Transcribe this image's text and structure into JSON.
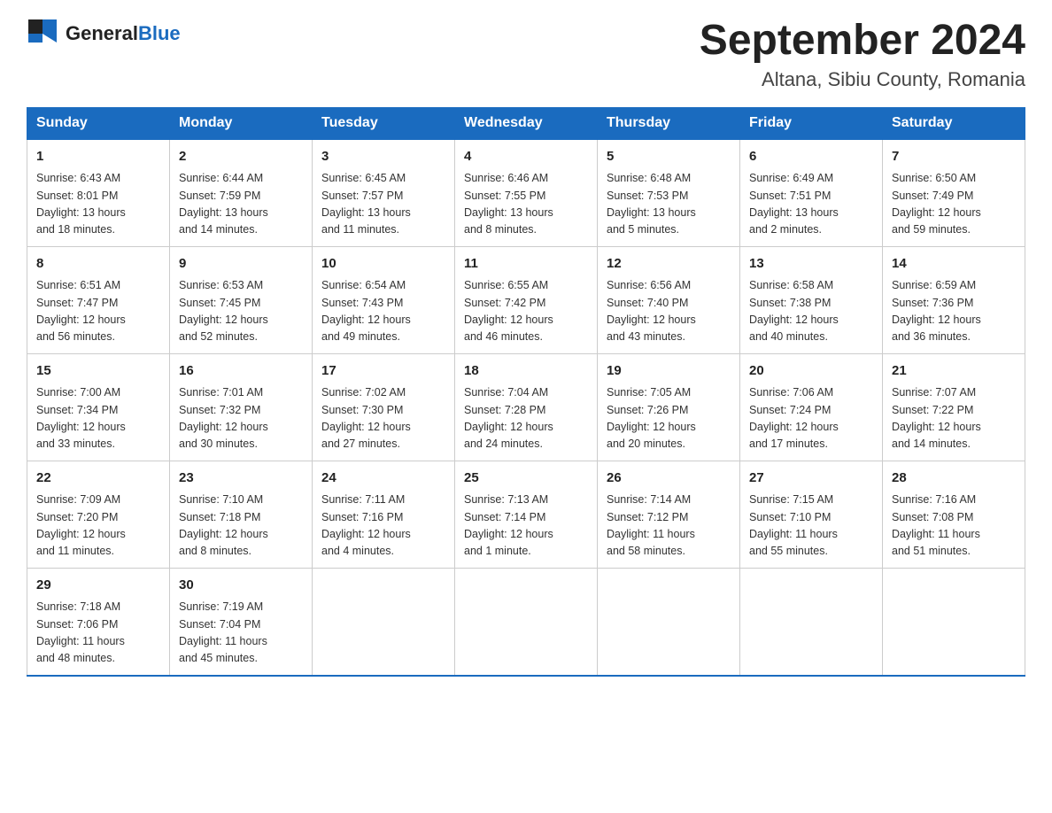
{
  "header": {
    "logo_general": "General",
    "logo_blue": "Blue",
    "title": "September 2024",
    "subtitle": "Altana, Sibiu County, Romania"
  },
  "columns": [
    "Sunday",
    "Monday",
    "Tuesday",
    "Wednesday",
    "Thursday",
    "Friday",
    "Saturday"
  ],
  "weeks": [
    [
      {
        "day": "1",
        "sunrise": "6:43 AM",
        "sunset": "8:01 PM",
        "daylight": "13 hours and 18 minutes."
      },
      {
        "day": "2",
        "sunrise": "6:44 AM",
        "sunset": "7:59 PM",
        "daylight": "13 hours and 14 minutes."
      },
      {
        "day": "3",
        "sunrise": "6:45 AM",
        "sunset": "7:57 PM",
        "daylight": "13 hours and 11 minutes."
      },
      {
        "day": "4",
        "sunrise": "6:46 AM",
        "sunset": "7:55 PM",
        "daylight": "13 hours and 8 minutes."
      },
      {
        "day": "5",
        "sunrise": "6:48 AM",
        "sunset": "7:53 PM",
        "daylight": "13 hours and 5 minutes."
      },
      {
        "day": "6",
        "sunrise": "6:49 AM",
        "sunset": "7:51 PM",
        "daylight": "13 hours and 2 minutes."
      },
      {
        "day": "7",
        "sunrise": "6:50 AM",
        "sunset": "7:49 PM",
        "daylight": "12 hours and 59 minutes."
      }
    ],
    [
      {
        "day": "8",
        "sunrise": "6:51 AM",
        "sunset": "7:47 PM",
        "daylight": "12 hours and 56 minutes."
      },
      {
        "day": "9",
        "sunrise": "6:53 AM",
        "sunset": "7:45 PM",
        "daylight": "12 hours and 52 minutes."
      },
      {
        "day": "10",
        "sunrise": "6:54 AM",
        "sunset": "7:43 PM",
        "daylight": "12 hours and 49 minutes."
      },
      {
        "day": "11",
        "sunrise": "6:55 AM",
        "sunset": "7:42 PM",
        "daylight": "12 hours and 46 minutes."
      },
      {
        "day": "12",
        "sunrise": "6:56 AM",
        "sunset": "7:40 PM",
        "daylight": "12 hours and 43 minutes."
      },
      {
        "day": "13",
        "sunrise": "6:58 AM",
        "sunset": "7:38 PM",
        "daylight": "12 hours and 40 minutes."
      },
      {
        "day": "14",
        "sunrise": "6:59 AM",
        "sunset": "7:36 PM",
        "daylight": "12 hours and 36 minutes."
      }
    ],
    [
      {
        "day": "15",
        "sunrise": "7:00 AM",
        "sunset": "7:34 PM",
        "daylight": "12 hours and 33 minutes."
      },
      {
        "day": "16",
        "sunrise": "7:01 AM",
        "sunset": "7:32 PM",
        "daylight": "12 hours and 30 minutes."
      },
      {
        "day": "17",
        "sunrise": "7:02 AM",
        "sunset": "7:30 PM",
        "daylight": "12 hours and 27 minutes."
      },
      {
        "day": "18",
        "sunrise": "7:04 AM",
        "sunset": "7:28 PM",
        "daylight": "12 hours and 24 minutes."
      },
      {
        "day": "19",
        "sunrise": "7:05 AM",
        "sunset": "7:26 PM",
        "daylight": "12 hours and 20 minutes."
      },
      {
        "day": "20",
        "sunrise": "7:06 AM",
        "sunset": "7:24 PM",
        "daylight": "12 hours and 17 minutes."
      },
      {
        "day": "21",
        "sunrise": "7:07 AM",
        "sunset": "7:22 PM",
        "daylight": "12 hours and 14 minutes."
      }
    ],
    [
      {
        "day": "22",
        "sunrise": "7:09 AM",
        "sunset": "7:20 PM",
        "daylight": "12 hours and 11 minutes."
      },
      {
        "day": "23",
        "sunrise": "7:10 AM",
        "sunset": "7:18 PM",
        "daylight": "12 hours and 8 minutes."
      },
      {
        "day": "24",
        "sunrise": "7:11 AM",
        "sunset": "7:16 PM",
        "daylight": "12 hours and 4 minutes."
      },
      {
        "day": "25",
        "sunrise": "7:13 AM",
        "sunset": "7:14 PM",
        "daylight": "12 hours and 1 minute."
      },
      {
        "day": "26",
        "sunrise": "7:14 AM",
        "sunset": "7:12 PM",
        "daylight": "11 hours and 58 minutes."
      },
      {
        "day": "27",
        "sunrise": "7:15 AM",
        "sunset": "7:10 PM",
        "daylight": "11 hours and 55 minutes."
      },
      {
        "day": "28",
        "sunrise": "7:16 AM",
        "sunset": "7:08 PM",
        "daylight": "11 hours and 51 minutes."
      }
    ],
    [
      {
        "day": "29",
        "sunrise": "7:18 AM",
        "sunset": "7:06 PM",
        "daylight": "11 hours and 48 minutes."
      },
      {
        "day": "30",
        "sunrise": "7:19 AM",
        "sunset": "7:04 PM",
        "daylight": "11 hours and 45 minutes."
      },
      null,
      null,
      null,
      null,
      null
    ]
  ],
  "labels": {
    "sunrise": "Sunrise:",
    "sunset": "Sunset:",
    "daylight": "Daylight:"
  }
}
